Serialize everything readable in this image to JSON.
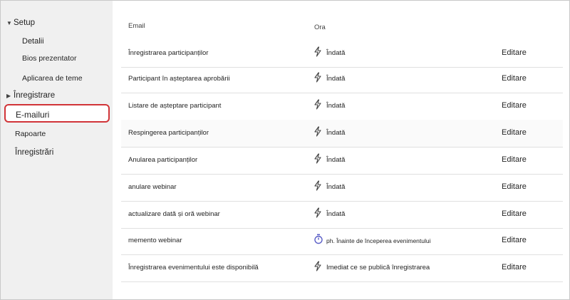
{
  "sidebar": {
    "setup_label": "Setup",
    "items": [
      {
        "label": "Detalii"
      },
      {
        "label": "Bios prezentator"
      },
      {
        "label": "Aplicarea de teme"
      }
    ],
    "inregistrare_label": "Înregistrare",
    "emails_label": "E-mailuri",
    "rapoarte_label": "Rapoarte",
    "inregistrari_label": "Înregistrări",
    "selected_border_color": "#d13438"
  },
  "table": {
    "columns": {
      "email": "Email",
      "ora": "Ora"
    },
    "edit_label": "Editare",
    "rows": [
      {
        "name": "Înregistrarea participanților",
        "time": "Îndată",
        "icon": "lightning-icon"
      },
      {
        "name": "Participant în așteptarea aprobării",
        "time": "Îndată",
        "icon": "lightning-icon"
      },
      {
        "name": "Listare de așteptare participant",
        "time": "Îndată",
        "icon": "lightning-icon"
      },
      {
        "name": "Respingerea participanților",
        "time": "Îndată",
        "icon": "lightning-icon"
      },
      {
        "name": "Anularea participanților",
        "time": "Îndată",
        "icon": "lightning-icon"
      },
      {
        "name": "anulare webinar",
        "time": "Îndată",
        "icon": "lightning-icon"
      },
      {
        "name": "actualizare dată și oră webinar",
        "time": "Îndată",
        "icon": "lightning-icon"
      },
      {
        "name": "memento webinar",
        "time": "ph. Înainte de începerea evenimentului",
        "icon": "timer-icon"
      },
      {
        "name": "Înregistrarea evenimentului este disponibilă",
        "time": "Imediat ce se publică înregistrarea",
        "icon": "lightning-icon"
      }
    ]
  }
}
